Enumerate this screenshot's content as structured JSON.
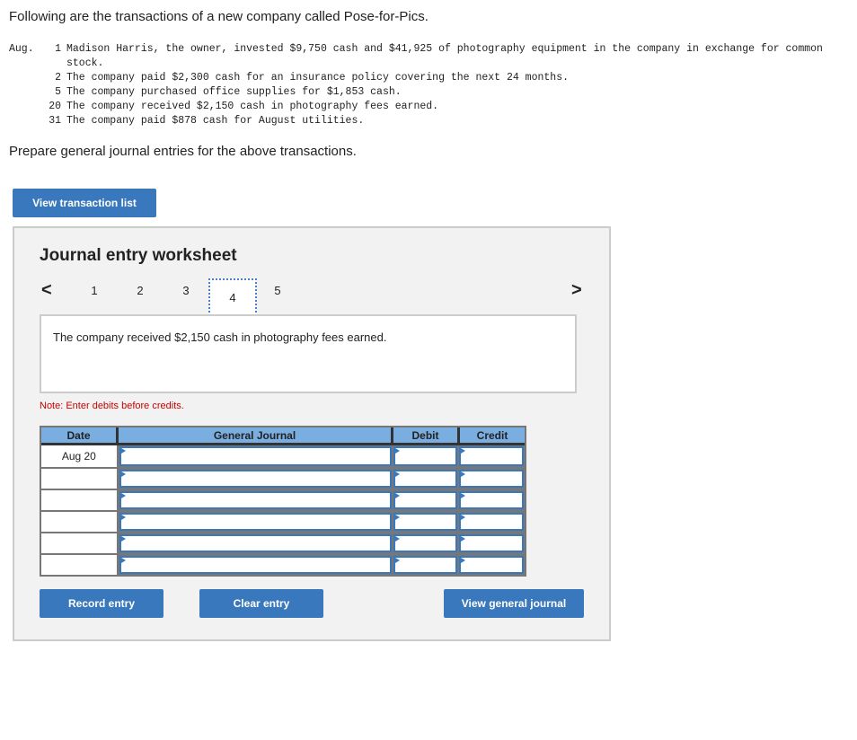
{
  "intro": "Following are the transactions of a new company called Pose-for-Pics.",
  "month": "Aug.",
  "transactions": [
    {
      "day": "1",
      "text": "Madison Harris, the owner, invested $9,750 cash and $41,925 of photography equipment in the company in exchange for common stock."
    },
    {
      "day": "2",
      "text": "The company paid $2,300 cash for an insurance policy covering the next 24 months."
    },
    {
      "day": "5",
      "text": "The company purchased office supplies for $1,853 cash."
    },
    {
      "day": "20",
      "text": "The company received $2,150 cash in photography fees earned."
    },
    {
      "day": "31",
      "text": "The company paid $878 cash for August utilities."
    }
  ],
  "prompt": "Prepare general journal entries for the above transactions.",
  "view_transaction_list": "View transaction list",
  "worksheet": {
    "title": "Journal entry worksheet",
    "prev": "<",
    "next": ">",
    "tabs": [
      "1",
      "2",
      "3",
      "4",
      "5"
    ],
    "active_tab": "4",
    "description": "The company received $2,150 cash in photography fees earned.",
    "note": "Note: Enter debits before credits.",
    "columns": [
      "Date",
      "General Journal",
      "Debit",
      "Credit"
    ],
    "rows": [
      {
        "date": "Aug 20"
      },
      {
        "date": ""
      },
      {
        "date": ""
      },
      {
        "date": ""
      },
      {
        "date": ""
      },
      {
        "date": ""
      }
    ],
    "record": "Record entry",
    "clear": "Clear entry",
    "view_journal": "View general journal"
  },
  "colors": {
    "accent": "#3a78bd",
    "header": "#7aade0",
    "note": "#cc0000"
  }
}
